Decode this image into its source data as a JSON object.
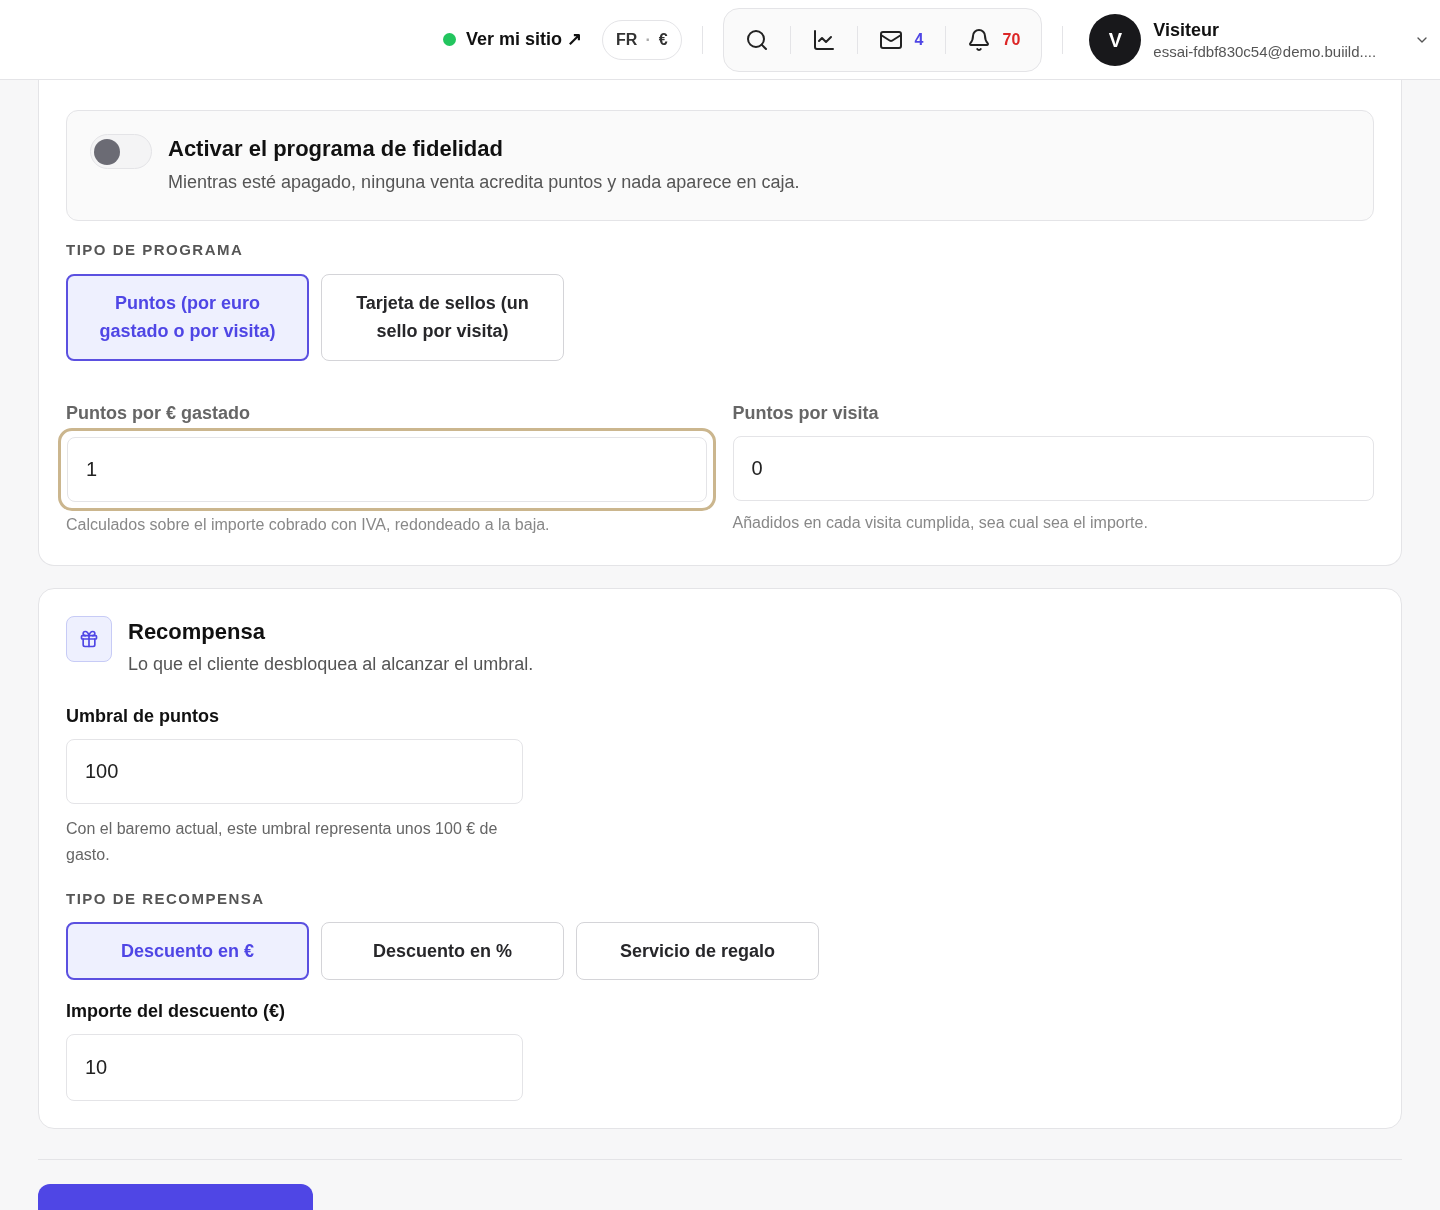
{
  "header": {
    "site_link": {
      "label": "Ver mi sitio ↗",
      "online": true
    },
    "locale": {
      "language": "FR",
      "separator": "·",
      "currency": "€"
    },
    "toolbar": [
      {
        "kind": "search"
      },
      {
        "kind": "stats"
      },
      {
        "kind": "mail",
        "count": "4"
      },
      {
        "kind": "bell",
        "count": "70"
      }
    ],
    "user": {
      "initial": "V",
      "name": "Visiteur",
      "email": "essai-fdbf830c54@demo.buiild...."
    }
  },
  "program": {
    "toggle": {
      "title": "Activar el programa de fidelidad",
      "description": "Mientras esté apagado, ninguna venta acredita puntos y nada aparece en caja.",
      "on": false
    },
    "type_label": "TIPO DE PROGRAMA",
    "types": [
      {
        "label": "Puntos (por euro gastado o por visita)",
        "selected": true
      },
      {
        "label": "Tarjeta de sellos (un sello por visita)",
        "selected": false
      }
    ],
    "fields": [
      {
        "label": "Puntos por € gastado",
        "value": "1",
        "hint": "Calculados sobre el importe cobrado con IVA, redondeado a la baja.",
        "focused": true
      },
      {
        "label": "Puntos por visita",
        "value": "0",
        "hint": "Añadidos en cada visita cumplida, sea cual sea el importe.",
        "focused": false
      }
    ]
  },
  "reward": {
    "title": "Recompensa",
    "subtitle": "Lo que el cliente desbloquea al alcanzar el umbral.",
    "threshold": {
      "label": "Umbral de puntos",
      "value": "100",
      "hint": "Con el baremo actual, este umbral representa unos 100 € de gasto."
    },
    "type_label": "TIPO DE RECOMPENSA",
    "types": [
      {
        "label": "Descuento en €",
        "selected": true
      },
      {
        "label": "Descuento en %",
        "selected": false
      },
      {
        "label": "Servicio de regalo",
        "selected": false
      }
    ],
    "amount": {
      "label": "Importe del descuento (€)",
      "value": "10"
    }
  }
}
